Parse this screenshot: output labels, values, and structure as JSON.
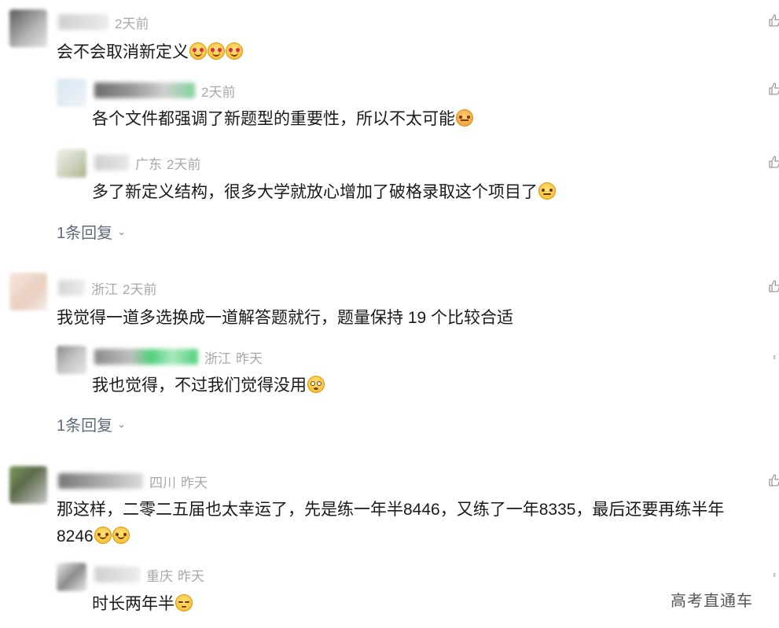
{
  "comments": [
    {
      "meta": {
        "location": "",
        "time": "2天前"
      },
      "text": "会不会取消新定义",
      "emoji_count": 3,
      "emoji_icon": "heart-eyes-emoji-icon"
    },
    {
      "meta": {
        "location": "",
        "time": "2天前"
      },
      "text": "各个文件都强调了新题型的重要性，所以不太可能",
      "emoji_icon": "thinking-face-emoji-icon"
    },
    {
      "meta": {
        "location": "广东",
        "time": "2天前"
      },
      "text": "多了新定义结构，很多大学就放心增加了破格录取这个项目了",
      "emoji_icon": "shushing-face-emoji-icon"
    },
    {
      "reply_more": "1条回复"
    },
    {
      "meta": {
        "location": "浙江",
        "time": "2天前"
      },
      "text": "我觉得一道多选换成一道解答题就行，题量保持 19 个比较合适"
    },
    {
      "meta": {
        "location": "浙江",
        "time": "昨天"
      },
      "text": "我也觉得，不过我们觉得没用",
      "emoji_icon": "flushed-face-emoji-icon"
    },
    {
      "reply_more": "1条回复"
    },
    {
      "meta": {
        "location": "四川",
        "time": "昨天"
      },
      "text_line1": "那这样，二零二五届也太幸运了，先是练一年半8446，又练了一年8335，最后还要再练半年",
      "text_line2": "8246",
      "emoji_icon": "smiling-face-emoji-icon"
    },
    {
      "meta": {
        "location": "重庆",
        "time": "昨天"
      },
      "text": "时长两年半",
      "emoji_icon": "sleepy-face-emoji-icon"
    }
  ],
  "watermark": "高考直通车",
  "colors": {
    "meta": "#a8a8a8",
    "text": "#1a1a1a",
    "reply_link": "#5f6b7a"
  }
}
